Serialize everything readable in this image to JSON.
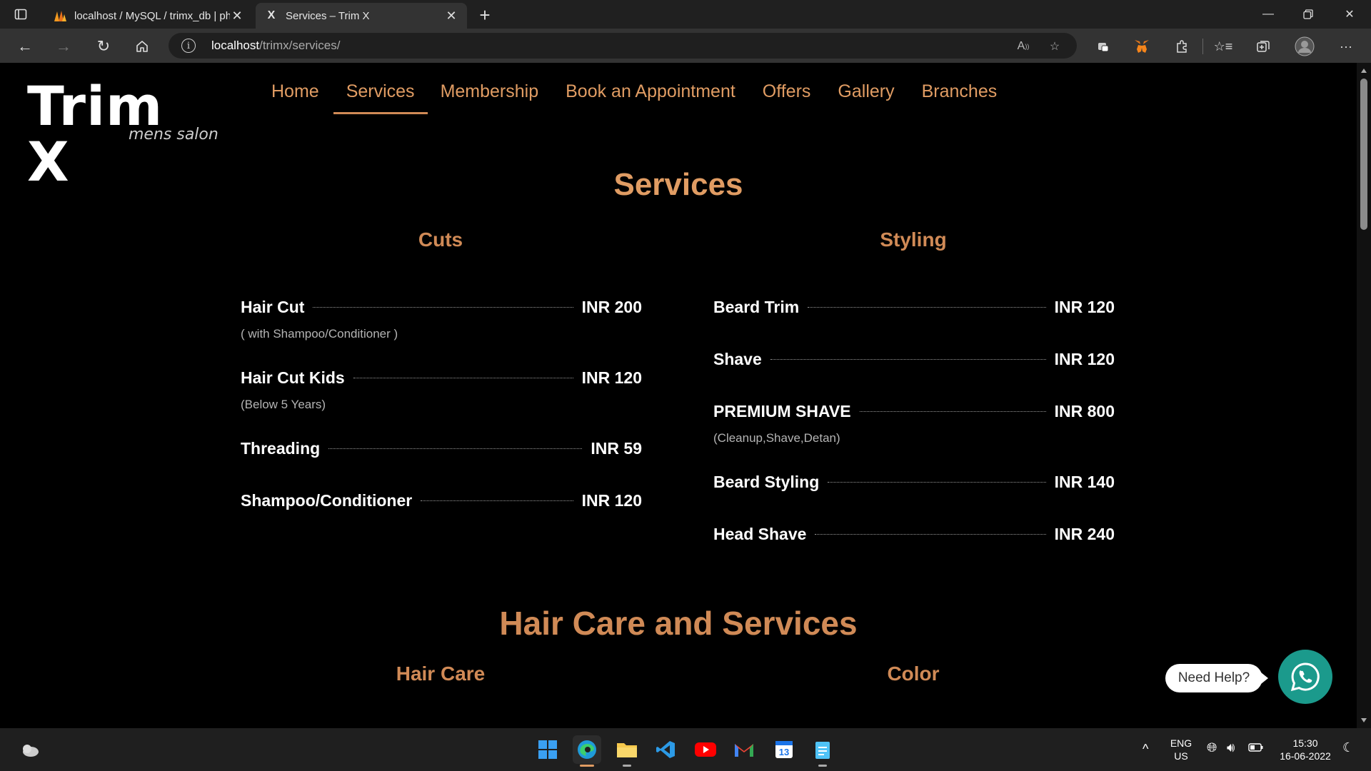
{
  "browser": {
    "tabs": [
      {
        "title": "localhost / MySQL / trimx_db | php",
        "active": false,
        "favicon": "phpmyadmin-icon"
      },
      {
        "title": "Services – Trim X",
        "active": true,
        "favicon": "X"
      }
    ],
    "url_host": "localhost",
    "url_path": "/trimx/services/"
  },
  "site": {
    "logo_name": "Trim X",
    "logo_tag": "mens salon",
    "nav": [
      "Home",
      "Services",
      "Membership",
      "Book an Appointment",
      "Offers",
      "Gallery",
      "Branches"
    ],
    "active_nav": "Services"
  },
  "page": {
    "title": "Services",
    "cuts": {
      "title": "Cuts",
      "items": [
        {
          "name": "Hair Cut",
          "price": "INR 200",
          "note": "( with Shampoo/Conditioner )"
        },
        {
          "name": "Hair Cut Kids",
          "price": "INR 120",
          "note": "(Below 5 Years)"
        },
        {
          "name": "Threading",
          "price": "INR 59",
          "note": ""
        },
        {
          "name": "Shampoo/Conditioner",
          "price": "INR 120",
          "note": ""
        }
      ]
    },
    "styling": {
      "title": "Styling",
      "items": [
        {
          "name": "Beard Trim",
          "price": "INR 120",
          "note": ""
        },
        {
          "name": "Shave",
          "price": "INR 120",
          "note": ""
        },
        {
          "name": "PREMIUM SHAVE",
          "price": "INR 800",
          "note": "(Cleanup,Shave,Detan)"
        },
        {
          "name": "Beard Styling",
          "price": "INR 140",
          "note": ""
        },
        {
          "name": "Head Shave",
          "price": "INR 240",
          "note": ""
        }
      ]
    },
    "hair_care_section": {
      "title": "Hair Care and Services",
      "left_title": "Hair Care",
      "right_title": "Color"
    },
    "help_label": "Need Help?"
  },
  "taskbar": {
    "lang_top": "ENG",
    "lang_bottom": "US",
    "time": "15:30",
    "date": "16-06-2022",
    "calendar_day": "13"
  },
  "colors": {
    "accent": "#e09c63",
    "accent_dark": "#d08a56",
    "whatsapp": "#1b9a8c"
  }
}
